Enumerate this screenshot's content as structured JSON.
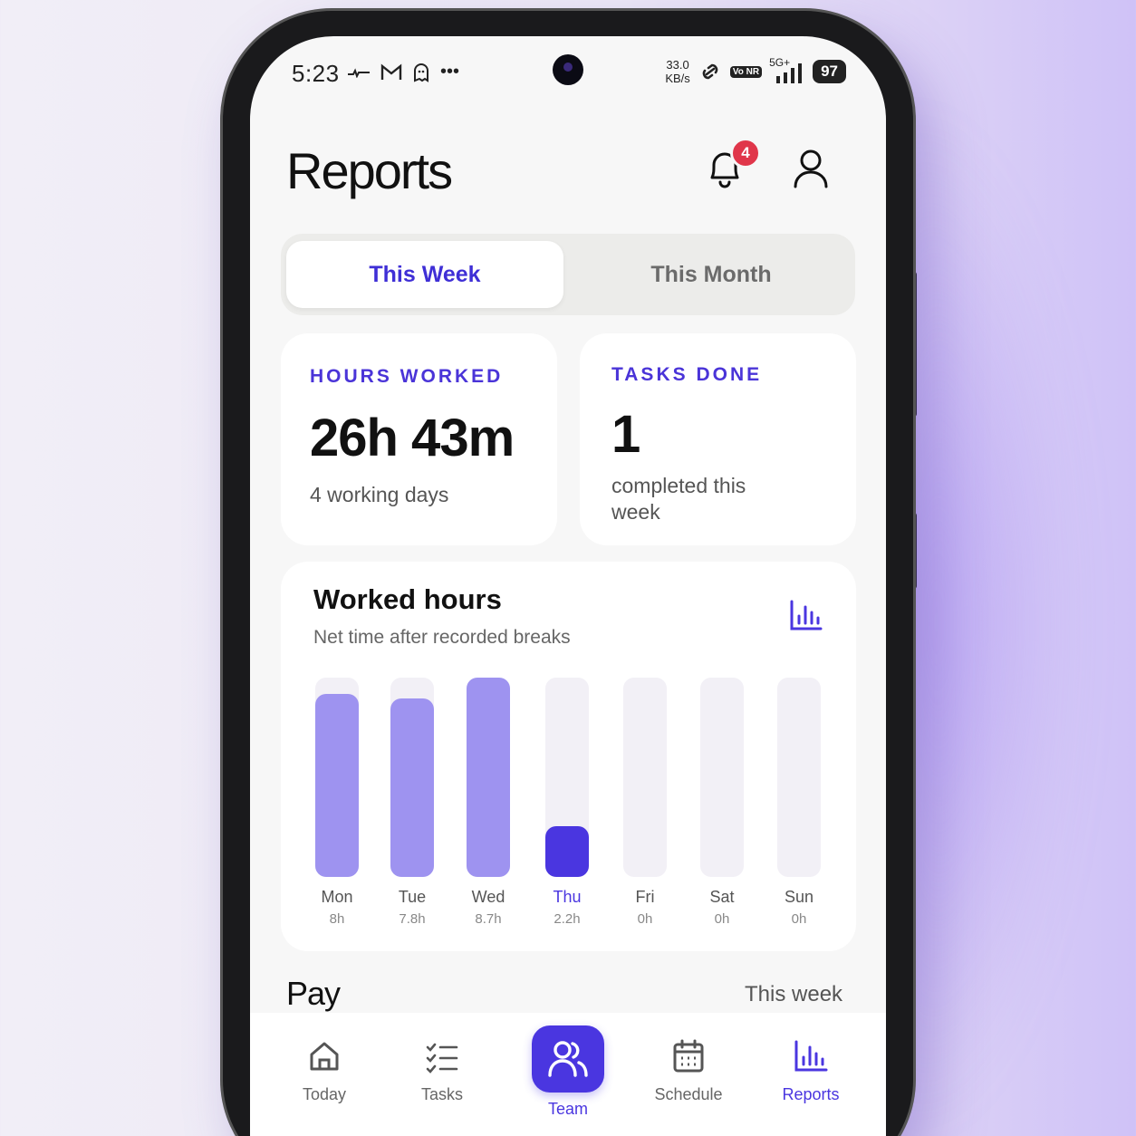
{
  "status_bar": {
    "time": "5:23",
    "net_speed_value": "33.0",
    "net_speed_unit": "KB/s",
    "vonr": "Vo NR",
    "network": "5G+",
    "battery": "97"
  },
  "header": {
    "title": "Reports",
    "notification_count": "4"
  },
  "segments": {
    "active": "This Week",
    "inactive": "This Month"
  },
  "stats": {
    "hours": {
      "label": "HOURS WORKED",
      "value": "26h 43m",
      "sub": "4 working days"
    },
    "tasks": {
      "label": "TASKS DONE",
      "value": "1",
      "sub": "completed this week"
    }
  },
  "worked_hours": {
    "title": "Worked hours",
    "subtitle": "Net time after recorded breaks"
  },
  "chart_data": {
    "type": "bar",
    "categories": [
      "Mon",
      "Tue",
      "Wed",
      "Thu",
      "Fri",
      "Sat",
      "Sun"
    ],
    "values": [
      8,
      7.8,
      8.7,
      2.2,
      0,
      0,
      0
    ],
    "value_labels": [
      "8h",
      "7.8h",
      "8.7h",
      "2.2h",
      "0h",
      "0h",
      "0h"
    ],
    "highlight": "Thu",
    "ylim": [
      0,
      8.7
    ],
    "title": "Worked hours",
    "colors": {
      "bar": "#9e93f0",
      "highlight": "#4a36e0",
      "track": "#f2f0f6"
    }
  },
  "pay": {
    "title": "Pay",
    "period": "This week"
  },
  "tabbar": {
    "today": "Today",
    "tasks": "Tasks",
    "team": "Team",
    "schedule": "Schedule",
    "reports": "Reports"
  },
  "colors": {
    "accent": "#4a36e0",
    "badge": "#e0364a"
  }
}
